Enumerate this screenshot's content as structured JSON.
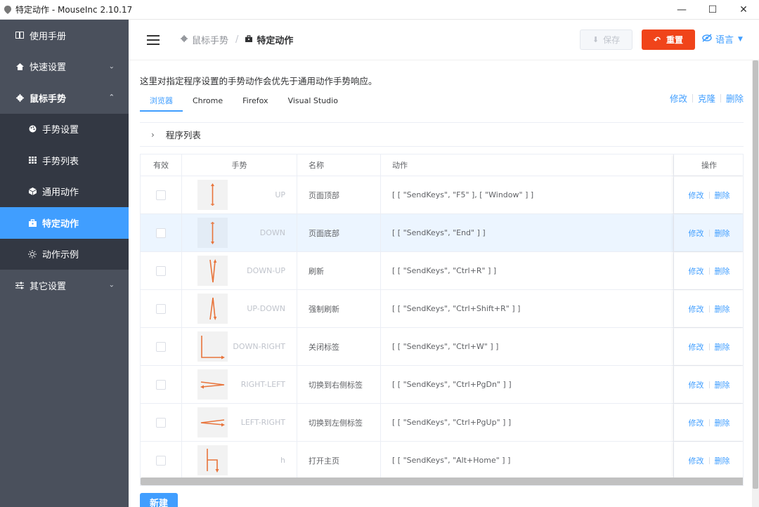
{
  "window": {
    "title": "特定动作 - MouseInc 2.10.17",
    "minimize_glyph": "—",
    "maximize_glyph": "☐",
    "close_glyph": "✕"
  },
  "sidebar": {
    "items": [
      {
        "label": "使用手册",
        "icon": "book-icon"
      },
      {
        "label": "快速设置",
        "icon": "home-icon",
        "chevron": "⌄"
      },
      {
        "label": "鼠标手势",
        "icon": "gear-icon",
        "chevron": "⌃"
      },
      {
        "label": "手势设置",
        "icon": "palette-icon"
      },
      {
        "label": "手势列表",
        "icon": "grid-icon"
      },
      {
        "label": "通用动作",
        "icon": "cube-icon"
      },
      {
        "label": "特定动作",
        "icon": "bag-icon"
      },
      {
        "label": "动作示例",
        "icon": "sun-icon"
      },
      {
        "label": "其它设置",
        "icon": "sliders-icon",
        "chevron": "⌄"
      }
    ]
  },
  "header": {
    "breadcrumb": {
      "parent": "鼠标手势",
      "current": "特定动作"
    },
    "save_label": "保存",
    "reset_label": "重置",
    "language_label": "语言"
  },
  "main": {
    "note": "这里对指定程序设置的手势动作会优先于通用动作手势响应。",
    "tabs": [
      {
        "label": "浏览器",
        "active": true
      },
      {
        "label": "Chrome"
      },
      {
        "label": "Firefox"
      },
      {
        "label": "Visual Studio"
      }
    ],
    "tab_actions": {
      "edit": "修改",
      "clone": "克隆",
      "delete": "删除"
    },
    "collapse_title": "程序列表",
    "table": {
      "headers": {
        "valid": "有效",
        "gesture": "手势",
        "name": "名称",
        "action": "动作",
        "ops": "操作"
      },
      "rows": [
        {
          "gesture": "UP",
          "name": "页面顶部",
          "action": "[ [ \"SendKeys\", \"F5\" ], [ \"Window\" ] ]",
          "edit": "修改",
          "delete": "删除"
        },
        {
          "gesture": "DOWN",
          "name": "页面底部",
          "action": "[ [ \"SendKeys\", \"End\" ] ]",
          "edit": "修改",
          "delete": "删除"
        },
        {
          "gesture": "DOWN-UP",
          "name": "刷新",
          "action": "[ [ \"SendKeys\", \"Ctrl+R\" ] ]",
          "edit": "修改",
          "delete": "删除"
        },
        {
          "gesture": "UP-DOWN",
          "name": "强制刷新",
          "action": "[ [ \"SendKeys\", \"Ctrl+Shift+R\" ] ]",
          "edit": "修改",
          "delete": "删除"
        },
        {
          "gesture": "DOWN-RIGHT",
          "name": "关闭标签",
          "action": "[ [ \"SendKeys\", \"Ctrl+W\" ] ]",
          "edit": "修改",
          "delete": "删除"
        },
        {
          "gesture": "RIGHT-LEFT",
          "name": "切换到右侧标签",
          "action": "[ [ \"SendKeys\", \"Ctrl+PgDn\" ] ]",
          "edit": "修改",
          "delete": "删除"
        },
        {
          "gesture": "LEFT-RIGHT",
          "name": "切换到左侧标签",
          "action": "[ [ \"SendKeys\", \"Ctrl+PgUp\" ] ]",
          "edit": "修改",
          "delete": "删除"
        },
        {
          "gesture": "h",
          "name": "打开主页",
          "action": "[ [ \"SendKeys\", \"Alt+Home\" ] ]",
          "edit": "修改",
          "delete": "删除"
        }
      ]
    },
    "new_label": "新建"
  },
  "colors": {
    "accent": "#409eff",
    "danger": "#f0441a",
    "sidebar": "#4a505c",
    "gesture_stroke": "#e8743b"
  }
}
